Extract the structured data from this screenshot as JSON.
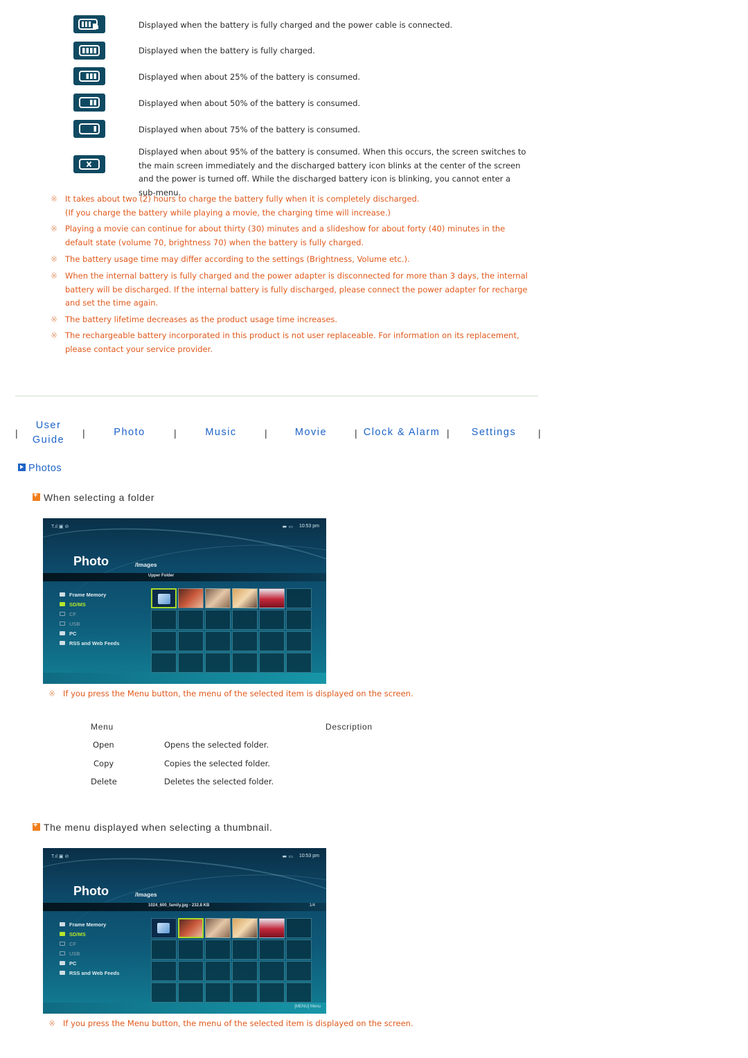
{
  "battery_icons": [
    {
      "icon": "battery-charging-icon",
      "text": "Displayed when the battery is fully charged and the power cable is connected."
    },
    {
      "icon": "battery-full-icon",
      "text": "Displayed when the battery is fully charged."
    },
    {
      "icon": "battery-75-icon",
      "text": "Displayed when about 25% of the battery is consumed."
    },
    {
      "icon": "battery-50-icon",
      "text": "Displayed when about 50% of the battery is consumed."
    },
    {
      "icon": "battery-25-icon",
      "text": "Displayed when about 75% of the battery is consumed."
    },
    {
      "icon": "battery-empty-icon",
      "text": "Displayed when about 95% of the battery is consumed. When this occurs, the screen switches to the main screen immediately and the discharged battery icon blinks at the center of the screen and the power is turned off. While the discharged battery icon is blinking, you cannot enter a sub-menu."
    }
  ],
  "note_mark": "※",
  "notes": [
    "It takes about two (2) hours to charge the battery fully when it is completely discharged.\n(If you charge the battery while playing a movie, the charging time will increase.)",
    "Playing a movie can continue for about thirty (30) minutes and a slideshow for about forty (40) minutes in the default state (volume 70, brightness 70) when the battery is fully charged.",
    "The battery usage time may differ according to the settings (Brightness, Volume etc.).",
    "When the internal battery is fully charged and the power adapter is disconnected for more than 3 days, the internal battery will be discharged. If the internal battery is fully discharged, please connect the power adapter for recharge and set the time again.",
    "The battery lifetime decreases as the product usage time increases.",
    "The rechargeable battery incorporated in this product is not user replaceable. For information on its replacement, please contact your service provider."
  ],
  "nav": {
    "separator": "|",
    "links": [
      "User Guide",
      "Photo",
      "Music",
      "Movie",
      "Clock & Alarm",
      "Settings"
    ]
  },
  "section_title": "Photos",
  "subsections": [
    {
      "title": "When selecting a folder"
    },
    {
      "title": "The menu displayed when selecting a thumbnail."
    }
  ],
  "screens": [
    {
      "status_left": "T.ıl ▣ ⊘",
      "status_icons": "▬ ▭",
      "time": "10:53 pm",
      "title": "Photo",
      "path": "/Images",
      "info": "Upper Folder",
      "page": "",
      "menu": [
        "Frame Memory",
        "SD/MS",
        "CF",
        "USB",
        "PC",
        "RSS and Web Feeds"
      ],
      "menu_hint": ""
    },
    {
      "status_left": "T.ıl ▣ ⊘",
      "status_icons": "▬ ▭",
      "time": "10:53 pm",
      "title": "Photo",
      "path": "/Images",
      "info": "1024_600_family.jpg - 232.8 KB",
      "page": "1/4",
      "menu": [
        "Frame Memory",
        "SD/MS",
        "CF",
        "USB",
        "PC",
        "RSS and Web Feeds"
      ],
      "menu_hint": "[MENU] Menu"
    }
  ],
  "menu_note": "If you press the Menu button, the menu of the selected item is displayed on the screen.",
  "menu_table": {
    "headers": [
      "Menu",
      "Description"
    ],
    "rows": [
      [
        "Open",
        "Opens the selected folder."
      ],
      [
        "Copy",
        "Copies the selected folder."
      ],
      [
        "Delete",
        "Deletes the selected folder."
      ]
    ]
  }
}
